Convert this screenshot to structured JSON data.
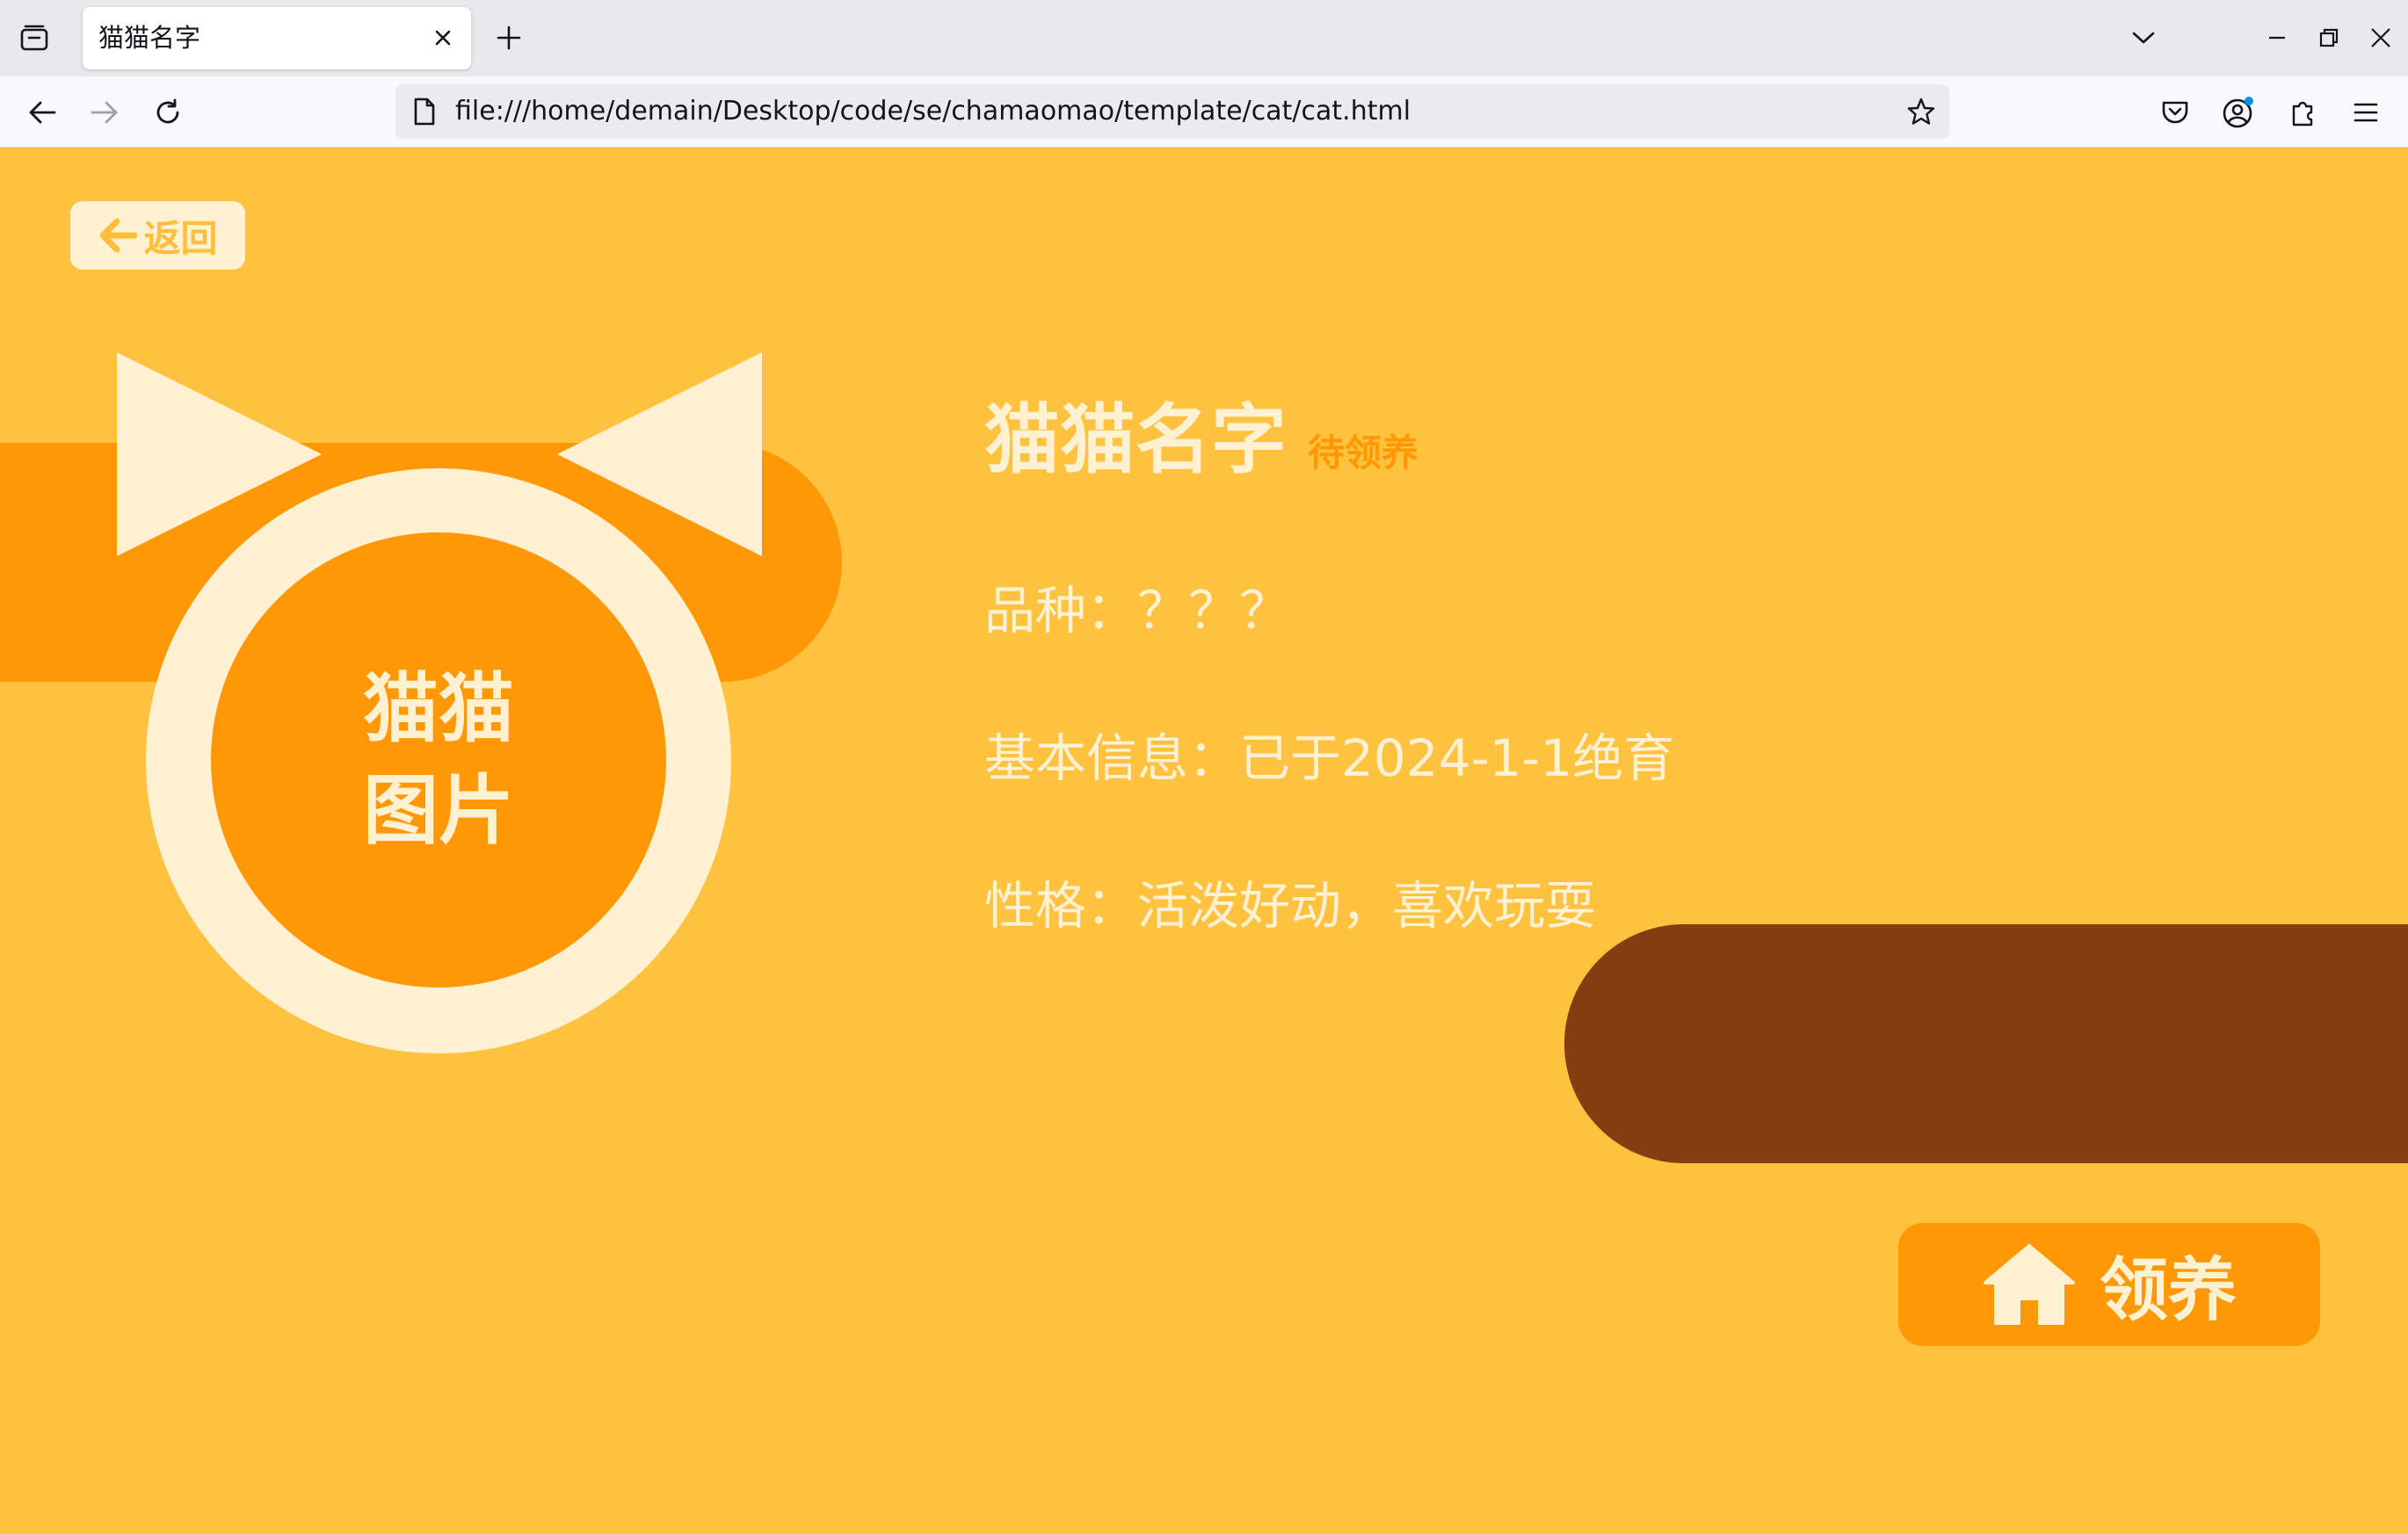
{
  "browser": {
    "tab_title": "猫猫名字",
    "url": "file:///home/demain/Desktop/code/se/chamaomao/template/cat/cat.html",
    "icons": {
      "tab_overview": "tab-overview-icon",
      "close": "close-icon",
      "new_tab": "plus-icon",
      "tab_list": "chevron-down-icon",
      "minimize": "minimize-icon",
      "restore": "restore-icon",
      "window_close": "close-icon",
      "back": "arrow-left-icon",
      "forward": "arrow-right-icon",
      "reload": "reload-icon",
      "page": "page-icon",
      "bookmark": "star-icon",
      "pocket": "pocket-icon",
      "account": "account-icon",
      "extensions": "puzzle-icon",
      "menu": "hamburger-icon"
    }
  },
  "page": {
    "back_button": {
      "label": "返回",
      "icon": "arrow-left-icon"
    },
    "photo_placeholder": {
      "line1": "猫猫",
      "line2": "图片"
    },
    "cat": {
      "name": "猫猫名字",
      "status": "待领养",
      "breed_line": "品种：？？？",
      "basic_info_line": "基本信息：已于2024-1-1绝育",
      "personality_line": "性格：活泼好动，喜欢玩耍"
    },
    "adopt_button": {
      "label": "领养",
      "icon": "house-icon"
    },
    "colors": {
      "background": "#ffc23f",
      "orange": "#ff9804",
      "cream": "#fff1d2",
      "brown": "#843d10"
    }
  }
}
